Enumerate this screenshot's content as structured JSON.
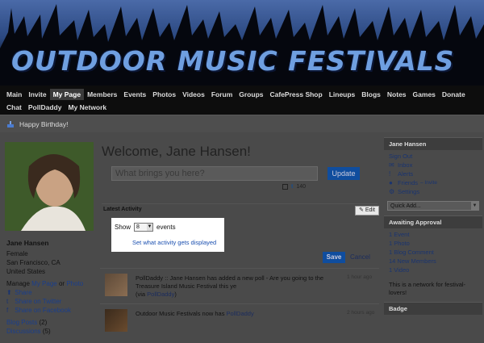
{
  "site": {
    "title": "OUTDOOR MUSIC FESTIVALS"
  },
  "nav": {
    "row1": [
      "Main",
      "Invite",
      "My Page",
      "Members",
      "Events",
      "Photos",
      "Videos",
      "Forum",
      "Groups",
      "CafePress Shop",
      "Lineups",
      "Blogs",
      "Notes",
      "Games",
      "Donate"
    ],
    "row2": [
      "Chat",
      "PollDaddy",
      "My Network"
    ],
    "active": "My Page"
  },
  "birthday": {
    "text": "Happy Birthday!"
  },
  "profile": {
    "name": "Jane Hansen",
    "gender": "Female",
    "location": "San Francisco, CA",
    "country": "United States",
    "manage_prefix": "Manage",
    "manage_page": "My Page",
    "manage_or": "or",
    "manage_photo": "Photo",
    "share": "Share",
    "share_twitter": "Share on Twitter",
    "share_facebook": "Share on Facebook",
    "blog_posts": "Blog Posts",
    "blog_posts_count": "(2)",
    "discussions": "Discussions",
    "discussions_count": "(5)"
  },
  "main": {
    "welcome": "Welcome, Jane Hansen!",
    "status_placeholder": "What brings you here?",
    "update_label": "Update",
    "char_count": "140",
    "activity_header": "Latest Activity",
    "edit_label": "Edit",
    "show_label": "Show",
    "show_value": "8",
    "events_label": "events",
    "set_link": "Set what activity gets displayed",
    "save_label": "Save",
    "cancel_label": "Cancel"
  },
  "feed": [
    {
      "text_prefix": "PollDaddy :: Jane Hansen has added a new poll - Are you going to the Treasure Island Music Festival this ye",
      "via_prefix": "(via ",
      "via_link": "PollDaddy",
      "via_suffix": ")",
      "time": "1 hour ago"
    },
    {
      "text_prefix": "Outdoor Music Festivals now has ",
      "link": "PollDaddy",
      "time": "2 hours ago"
    }
  ],
  "sidebar": {
    "user_header": "Jane Hansen",
    "sign_out": "Sign Out",
    "inbox": "Inbox",
    "alerts": "Alerts",
    "friends": "Friends",
    "friends_invite": "– Invite",
    "settings": "Settings",
    "quick_add": "Quick Add...",
    "awaiting_header": "Awaiting Approval",
    "awaiting": [
      "1 Event",
      "1 Photo",
      "1 Blog Comment",
      "14 New Members",
      "1 Video"
    ],
    "network_note": "This is a network for festival-lovers!",
    "badge_header": "Badge"
  }
}
